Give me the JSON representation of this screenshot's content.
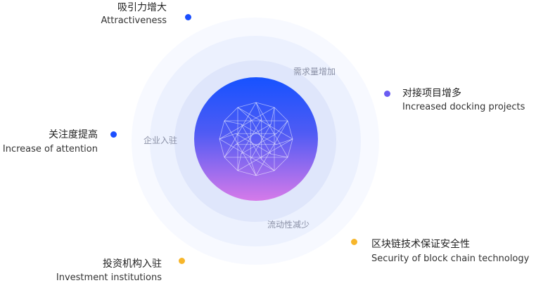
{
  "rings": {
    "top": "需求量增加",
    "left": "企业入驻",
    "bottom": "流动性减少"
  },
  "items": [
    {
      "title": "吸引力增大",
      "subtitle": "Attractiveness",
      "dot_color": "#1b4fff"
    },
    {
      "title": "对接项目增多",
      "subtitle": "Increased docking projects",
      "dot_color": "#6a5cf2"
    },
    {
      "title": "关注度提高",
      "subtitle": "Increase of attention",
      "dot_color": "#1b4fff"
    },
    {
      "title": "区块链技术保证安全性",
      "subtitle": "Security of block chain technology",
      "dot_color": "#f7b62b"
    },
    {
      "title": "投资机构入驻",
      "subtitle": "Investment institutions",
      "dot_color": "#f7b62b"
    }
  ]
}
